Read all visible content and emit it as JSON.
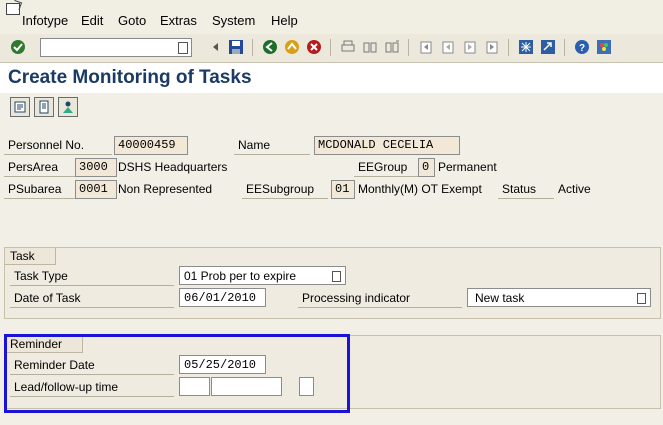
{
  "menubar": {
    "items": [
      "Infotype",
      "Edit",
      "Goto",
      "Extras",
      "System",
      "Help"
    ]
  },
  "toolbar": {
    "command_field_value": ""
  },
  "page": {
    "title": "Create Monitoring of Tasks"
  },
  "header": {
    "personnel_no_label": "Personnel No.",
    "personnel_no_value": "40000459",
    "name_label": "Name",
    "name_value": "MCDONALD CECELIA",
    "persarea_label": "PersArea",
    "persarea_code": "3000",
    "persarea_text": "DSHS Headquarters",
    "eegroup_label": "EEGroup",
    "eegroup_code": "0",
    "eegroup_text": "Permanent",
    "psubarea_label": "PSubarea",
    "psubarea_code": "0001",
    "psubarea_text": "Non Represented",
    "eesubgroup_label": "EESubgroup",
    "eesubgroup_code": "01",
    "eesubgroup_text": "Monthly(M) OT Exempt",
    "status_label": "Status",
    "status_value": "Active"
  },
  "task": {
    "title": "Task",
    "task_type_label": "Task Type",
    "task_type_value": "01 Prob per to expire",
    "date_label": "Date of Task",
    "date_value": "06/01/2010",
    "processing_label": "Processing indicator",
    "processing_value": "New task"
  },
  "reminder": {
    "title": "Reminder",
    "date_label": "Reminder Date",
    "date_value": "05/25/2010",
    "lead_label": "Lead/follow-up time",
    "lead_value1": "",
    "lead_value2": "",
    "lead_value3": ""
  },
  "colors": {
    "title": "#1b3a64",
    "highlight": "#1a12d6",
    "field_bg": "#f2e8d8"
  }
}
